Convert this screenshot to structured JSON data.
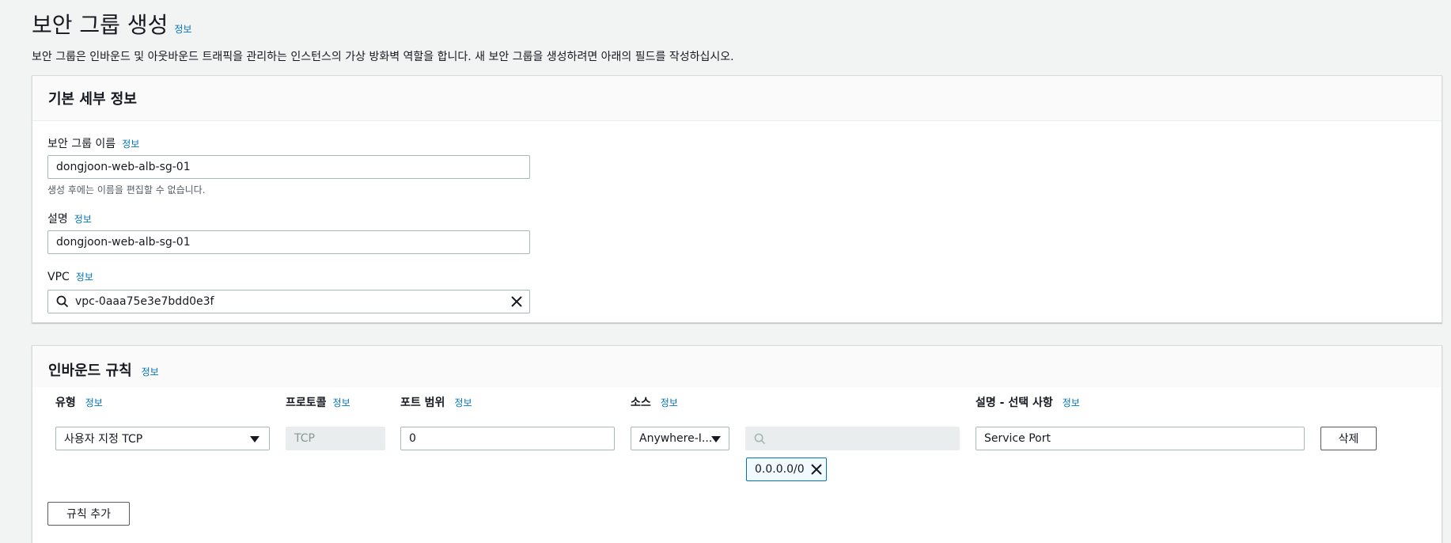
{
  "page": {
    "title": "보안 그룹 생성",
    "title_info": "정보",
    "description": "보안 그룹은 인바운드 및 아웃바운드 트래픽을 관리하는 인스턴스의 가상 방화벽 역할을 합니다. 새 보안 그룹을 생성하려면 아래의 필드를 작성하십시오."
  },
  "basic_details": {
    "title": "기본 세부 정보",
    "name_label": "보안 그룹 이름",
    "name_info": "정보",
    "name_value": "dongjoon-web-alb-sg-01",
    "name_hint": "생성 후에는 이름을 편집할 수 없습니다.",
    "desc_label": "설명",
    "desc_info": "정보",
    "desc_value": "dongjoon-web-alb-sg-01",
    "vpc_label": "VPC",
    "vpc_info": "정보",
    "vpc_value": "vpc-0aaa75e3e7bdd0e3f"
  },
  "inbound_rules": {
    "title": "인바운드 규칙",
    "title_info": "정보",
    "columns": {
      "type": "유형",
      "protocol": "프로토콜",
      "port_range": "포트 범위",
      "source": "소스",
      "description": "설명 - 선택 사항",
      "info": "정보"
    },
    "rows": [
      {
        "type": "사용자 지정 TCP",
        "protocol": "TCP",
        "port_range": "0",
        "source": "Anywhere-I...",
        "source_search": "",
        "source_token": "0.0.0.0/0",
        "description": "Service Port",
        "delete_label": "삭제"
      }
    ],
    "add_rule_label": "규칙 추가"
  },
  "icons": {
    "search": "search-icon",
    "clear": "close-icon",
    "caret": "caret-down-icon"
  },
  "colors": {
    "link": "#0073bb",
    "background": "#f2f3f3",
    "token_border": "#0073bb"
  }
}
